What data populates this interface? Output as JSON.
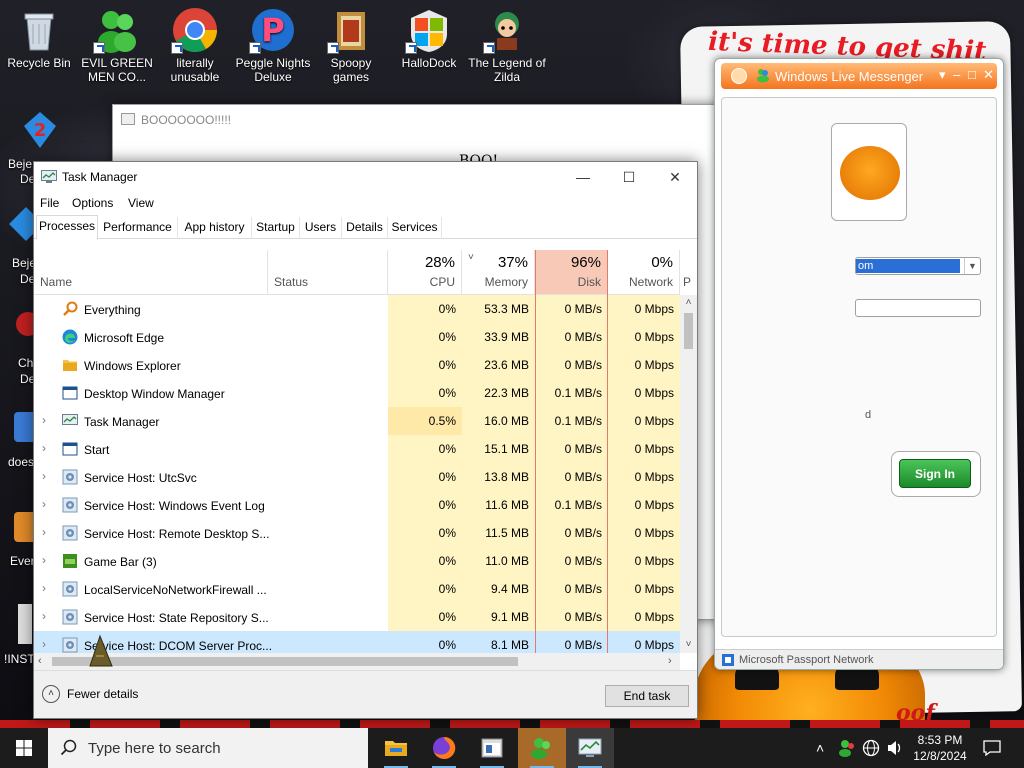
{
  "desktop": {
    "icons": [
      {
        "label": "Recycle Bin"
      },
      {
        "label": "EVIL GREEN MEN CO..."
      },
      {
        "label": "literally unusable"
      },
      {
        "label": "Peggle Nights Deluxe"
      },
      {
        "label": "Spoopy games"
      },
      {
        "label": "HalloDock"
      },
      {
        "label": "The Legend of Zilda"
      }
    ],
    "side_labels": [
      "Beje",
      "De",
      "Beje",
      "De",
      "Ch",
      "De",
      "does",
      "Ever",
      "!INST"
    ],
    "wallpaper_text": "it's time to get shit",
    "wallpaper_oof": "oof"
  },
  "boo_window": {
    "title": "BOOOOOOO!!!!!",
    "body_text": "BOO!"
  },
  "messenger": {
    "title": "Windows Live Messenger",
    "email_value": "om",
    "signin_label": "Sign In",
    "footer": "Microsoft Passport Network",
    "hint_d": "d"
  },
  "task_manager": {
    "title": "Task Manager",
    "menu": [
      "File",
      "Options",
      "View"
    ],
    "tabs": [
      "Processes",
      "Performance",
      "App history",
      "Startup",
      "Users",
      "Details",
      "Services"
    ],
    "active_tab": "Processes",
    "columns": {
      "name": "Name",
      "status": "Status",
      "cpu": {
        "pct": "28%",
        "label": "CPU"
      },
      "memory": {
        "pct": "37%",
        "label": "Memory"
      },
      "disk": {
        "pct": "96%",
        "label": "Disk"
      },
      "network": {
        "pct": "0%",
        "label": "Network"
      },
      "power": "P"
    },
    "rows": [
      {
        "name": "Everything",
        "cpu": "0%",
        "memory": "53.3 MB",
        "disk": "0 MB/s",
        "network": "0 Mbps",
        "expandable": false,
        "icon": "magnifier-icon"
      },
      {
        "name": "Microsoft Edge",
        "cpu": "0%",
        "memory": "33.9 MB",
        "disk": "0 MB/s",
        "network": "0 Mbps",
        "expandable": false,
        "icon": "edge-icon"
      },
      {
        "name": "Windows Explorer",
        "cpu": "0%",
        "memory": "23.6 MB",
        "disk": "0 MB/s",
        "network": "0 Mbps",
        "expandable": false,
        "icon": "folder-icon"
      },
      {
        "name": "Desktop Window Manager",
        "cpu": "0%",
        "memory": "22.3 MB",
        "disk": "0.1 MB/s",
        "network": "0 Mbps",
        "expandable": false,
        "icon": "window-icon"
      },
      {
        "name": "Task Manager",
        "cpu": "0.5%",
        "memory": "16.0 MB",
        "disk": "0.1 MB/s",
        "network": "0 Mbps",
        "expandable": true,
        "icon": "taskmgr-icon"
      },
      {
        "name": "Start",
        "cpu": "0%",
        "memory": "15.1 MB",
        "disk": "0 MB/s",
        "network": "0 Mbps",
        "expandable": true,
        "icon": "window-icon"
      },
      {
        "name": "Service Host: UtcSvc",
        "cpu": "0%",
        "memory": "13.8 MB",
        "disk": "0 MB/s",
        "network": "0 Mbps",
        "expandable": true,
        "icon": "gear-icon"
      },
      {
        "name": "Service Host: Windows Event Log",
        "cpu": "0%",
        "memory": "11.6 MB",
        "disk": "0.1 MB/s",
        "network": "0 Mbps",
        "expandable": true,
        "icon": "gear-icon"
      },
      {
        "name": "Service Host: Remote Desktop S...",
        "cpu": "0%",
        "memory": "11.5 MB",
        "disk": "0 MB/s",
        "network": "0 Mbps",
        "expandable": true,
        "icon": "gear-icon"
      },
      {
        "name": "Game Bar (3)",
        "cpu": "0%",
        "memory": "11.0 MB",
        "disk": "0 MB/s",
        "network": "0 Mbps",
        "expandable": true,
        "icon": "gamebar-icon"
      },
      {
        "name": "LocalServiceNoNetworkFirewall ...",
        "cpu": "0%",
        "memory": "9.4 MB",
        "disk": "0 MB/s",
        "network": "0 Mbps",
        "expandable": true,
        "icon": "gear-icon"
      },
      {
        "name": "Service Host: State Repository S...",
        "cpu": "0%",
        "memory": "9.1 MB",
        "disk": "0 MB/s",
        "network": "0 Mbps",
        "expandable": true,
        "icon": "gear-icon"
      },
      {
        "name": "Service Host: DCOM Server Proc...",
        "cpu": "0%",
        "memory": "8.1 MB",
        "disk": "0 MB/s",
        "network": "0 Mbps",
        "expandable": true,
        "icon": "gear-icon",
        "selected": true
      }
    ],
    "fewer_details": "Fewer details",
    "end_task": "End task"
  },
  "taskbar": {
    "search_placeholder": "Type here to search",
    "time": "8:53 PM",
    "date": "12/8/2024"
  },
  "colors": {
    "disk_header_hot": "#f9c9b7",
    "cell_bg": "#fff4c4",
    "selection": "#cce8ff",
    "accent": "#0078d7"
  }
}
